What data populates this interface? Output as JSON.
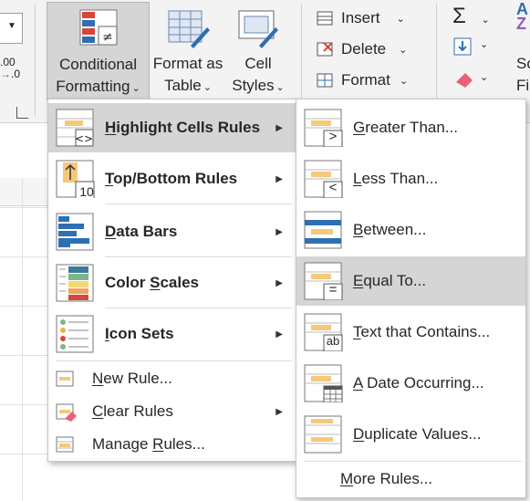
{
  "ribbon": {
    "number": {
      "dec1": ".00",
      "dec2": ".0"
    },
    "conditional_formatting": {
      "line1": "Conditional",
      "line2": "Formatting"
    },
    "format_as_table": {
      "line1": "Format as",
      "line2": "Table"
    },
    "cell_styles": {
      "line1": "Cell",
      "line2": "Styles"
    },
    "cells": {
      "insert": "Insert",
      "delete": "Delete",
      "format": "Format"
    },
    "editing": {
      "sort_partial1": "A",
      "sort_partial2": "Z",
      "sc": "Sc",
      "fil": "Fil"
    }
  },
  "cf_menu": {
    "items": [
      {
        "label": "Highlight Cells Rules",
        "mnemonic": "H",
        "rest": "ighlight Cells Rules"
      },
      {
        "label": "Top/Bottom Rules",
        "mnemonic": "T",
        "rest": "op/Bottom Rules",
        "icon_text": "10"
      },
      {
        "label": "Data Bars",
        "mnemonic": "D",
        "rest": "ata Bars"
      },
      {
        "label": "Color Scales",
        "pre": "Color ",
        "mnemonic": "S",
        "rest": "cales"
      },
      {
        "label": "Icon Sets",
        "mnemonic": "I",
        "rest": "con Sets"
      },
      {
        "label": "New Rule...",
        "mnemonic": "N",
        "rest": "ew Rule..."
      },
      {
        "label": "Clear Rules",
        "mnemonic": "C",
        "rest": "lear Rules"
      },
      {
        "label": "Manage Rules...",
        "pre": "Manage ",
        "mnemonic": "R",
        "rest": "ules..."
      }
    ]
  },
  "submenu": {
    "items": [
      {
        "label": "Greater Than...",
        "mnemonic": "G",
        "rest": "reater Than...",
        "icon_text": ">"
      },
      {
        "label": "Less Than...",
        "mnemonic": "L",
        "rest": "ess Than...",
        "icon_text": "<"
      },
      {
        "label": "Between...",
        "mnemonic": "B",
        "rest": "etween..."
      },
      {
        "label": "Equal To...",
        "mnemonic": "E",
        "rest": "qual To...",
        "icon_text": "="
      },
      {
        "label": "Text that Contains...",
        "mnemonic": "T",
        "rest": "ext that Contains...",
        "icon_text": "ab"
      },
      {
        "label": "A Date Occurring...",
        "mnemonic": "A",
        "rest": " Date Occurring..."
      },
      {
        "label": "Duplicate Values...",
        "mnemonic": "D",
        "rest": "uplicate Values..."
      },
      {
        "label": "More Rules...",
        "mnemonic": "M",
        "rest": "ore Rules..."
      }
    ]
  },
  "colors": {
    "highlight": "#d5d5d5",
    "accent_yellow": "#f5c97a",
    "accent_blue": "#2e6fb3",
    "accent_red": "#d8453b"
  }
}
